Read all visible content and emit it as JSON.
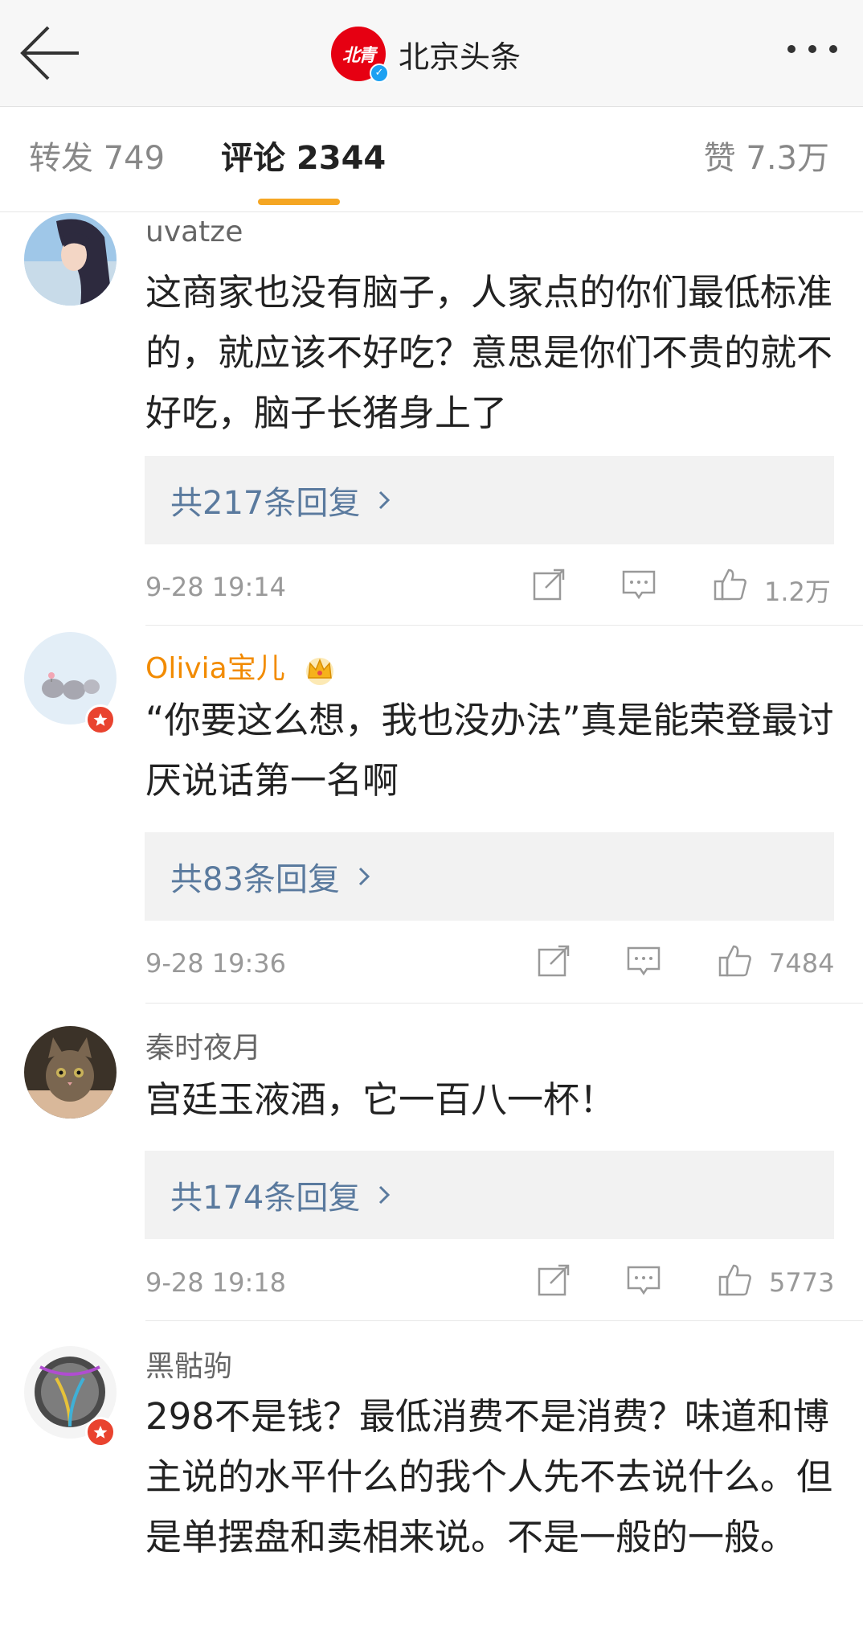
{
  "header": {
    "title": "北京头条",
    "logo_text": "北青"
  },
  "tabs": {
    "repost": "转发 749",
    "comment": "评论 2344",
    "like": "赞 7.3万"
  },
  "comments": [
    {
      "username": "uvatze",
      "text": "这商家也没有脑子，人家点的你们最低标准的，就应该不好吃？意思是你们不贵的就不好吃，脑子长猪身上了",
      "replies": "共217条回复",
      "time": "9-28 19:14",
      "likes": "1.2万"
    },
    {
      "username": "Olivia宝儿",
      "text": "“你要这么想，我也没办法”真是能荣登最讨厌说话第一名啊",
      "replies": "共83条回复",
      "time": "9-28 19:36",
      "likes": "7484"
    },
    {
      "username": "秦时夜月",
      "text": "宫廷玉液酒，它一百八一杯！",
      "replies": "共174条回复",
      "time": "9-28 19:18",
      "likes": "5773"
    },
    {
      "username": "黑骷驹",
      "text": "298不是钱？最低消费不是消费？味道和博主说的水平什么的我个人先不去说什么。但是单摆盘和卖相来说。不是一般的一般。"
    }
  ],
  "colors": {
    "accent_indicator": "#f5a623",
    "reply_link": "#5a7a9e",
    "vip_name": "#f28b00",
    "logo_red": "#e60012",
    "badge_red": "#e9432f"
  },
  "icons": {
    "back": "arrow-left-icon",
    "more": "more-dots-icon",
    "repost": "share-icon",
    "comment": "comment-icon",
    "like": "thumbs-up-icon",
    "crown": "crown-icon"
  }
}
